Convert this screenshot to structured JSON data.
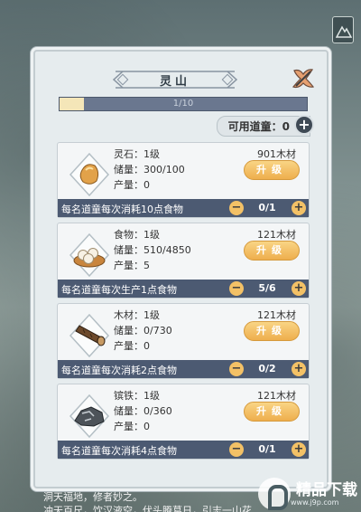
{
  "panel": {
    "title": "灵山",
    "progress": {
      "current": 1,
      "max": 10,
      "text": "1/10"
    },
    "workers": {
      "label": "可用道童：",
      "value": "0",
      "add_symbol": "+"
    }
  },
  "resources": [
    {
      "icon": "spirit-stone-icon",
      "lines": [
        "灵石：1级",
        "储量：300/100",
        "产量：0"
      ],
      "cost": "901木材",
      "upgrade_label": "升级",
      "bar_text": "每名道童每次消耗10点食物",
      "assigned": "0/1"
    },
    {
      "icon": "food-steamer-icon",
      "lines": [
        "食物：1级",
        "储量：510/4850",
        "产量：5"
      ],
      "cost": "121木材",
      "upgrade_label": "升级",
      "bar_text": "每名道童每次生产1点食物",
      "assigned": "5/6"
    },
    {
      "icon": "wood-log-icon",
      "lines": [
        "木材：1级",
        "储量：0/730",
        "产量：0"
      ],
      "cost": "121木材",
      "upgrade_label": "升级",
      "bar_text": "每名道童每次消耗2点食物",
      "assigned": "0/2"
    },
    {
      "icon": "iron-ore-icon",
      "lines": [
        "镔铁：1级",
        "储量：0/360",
        "产量：0"
      ],
      "cost": "121木材",
      "upgrade_label": "升级",
      "bar_text": "每名道童每次消耗4点食物",
      "assigned": "0/1"
    }
  ],
  "footer": {
    "line1": "洞天福地，修者妙之。",
    "line2": "冲天百尺，饮汉液空，伏头腾葛日，引志一山花"
  },
  "watermark": {
    "name": "精品下载",
    "url": "www.j9p.com"
  },
  "colors": {
    "bar": "#4c5a72",
    "upgrade": "#eeae4d",
    "panel": "#e6ecee"
  }
}
